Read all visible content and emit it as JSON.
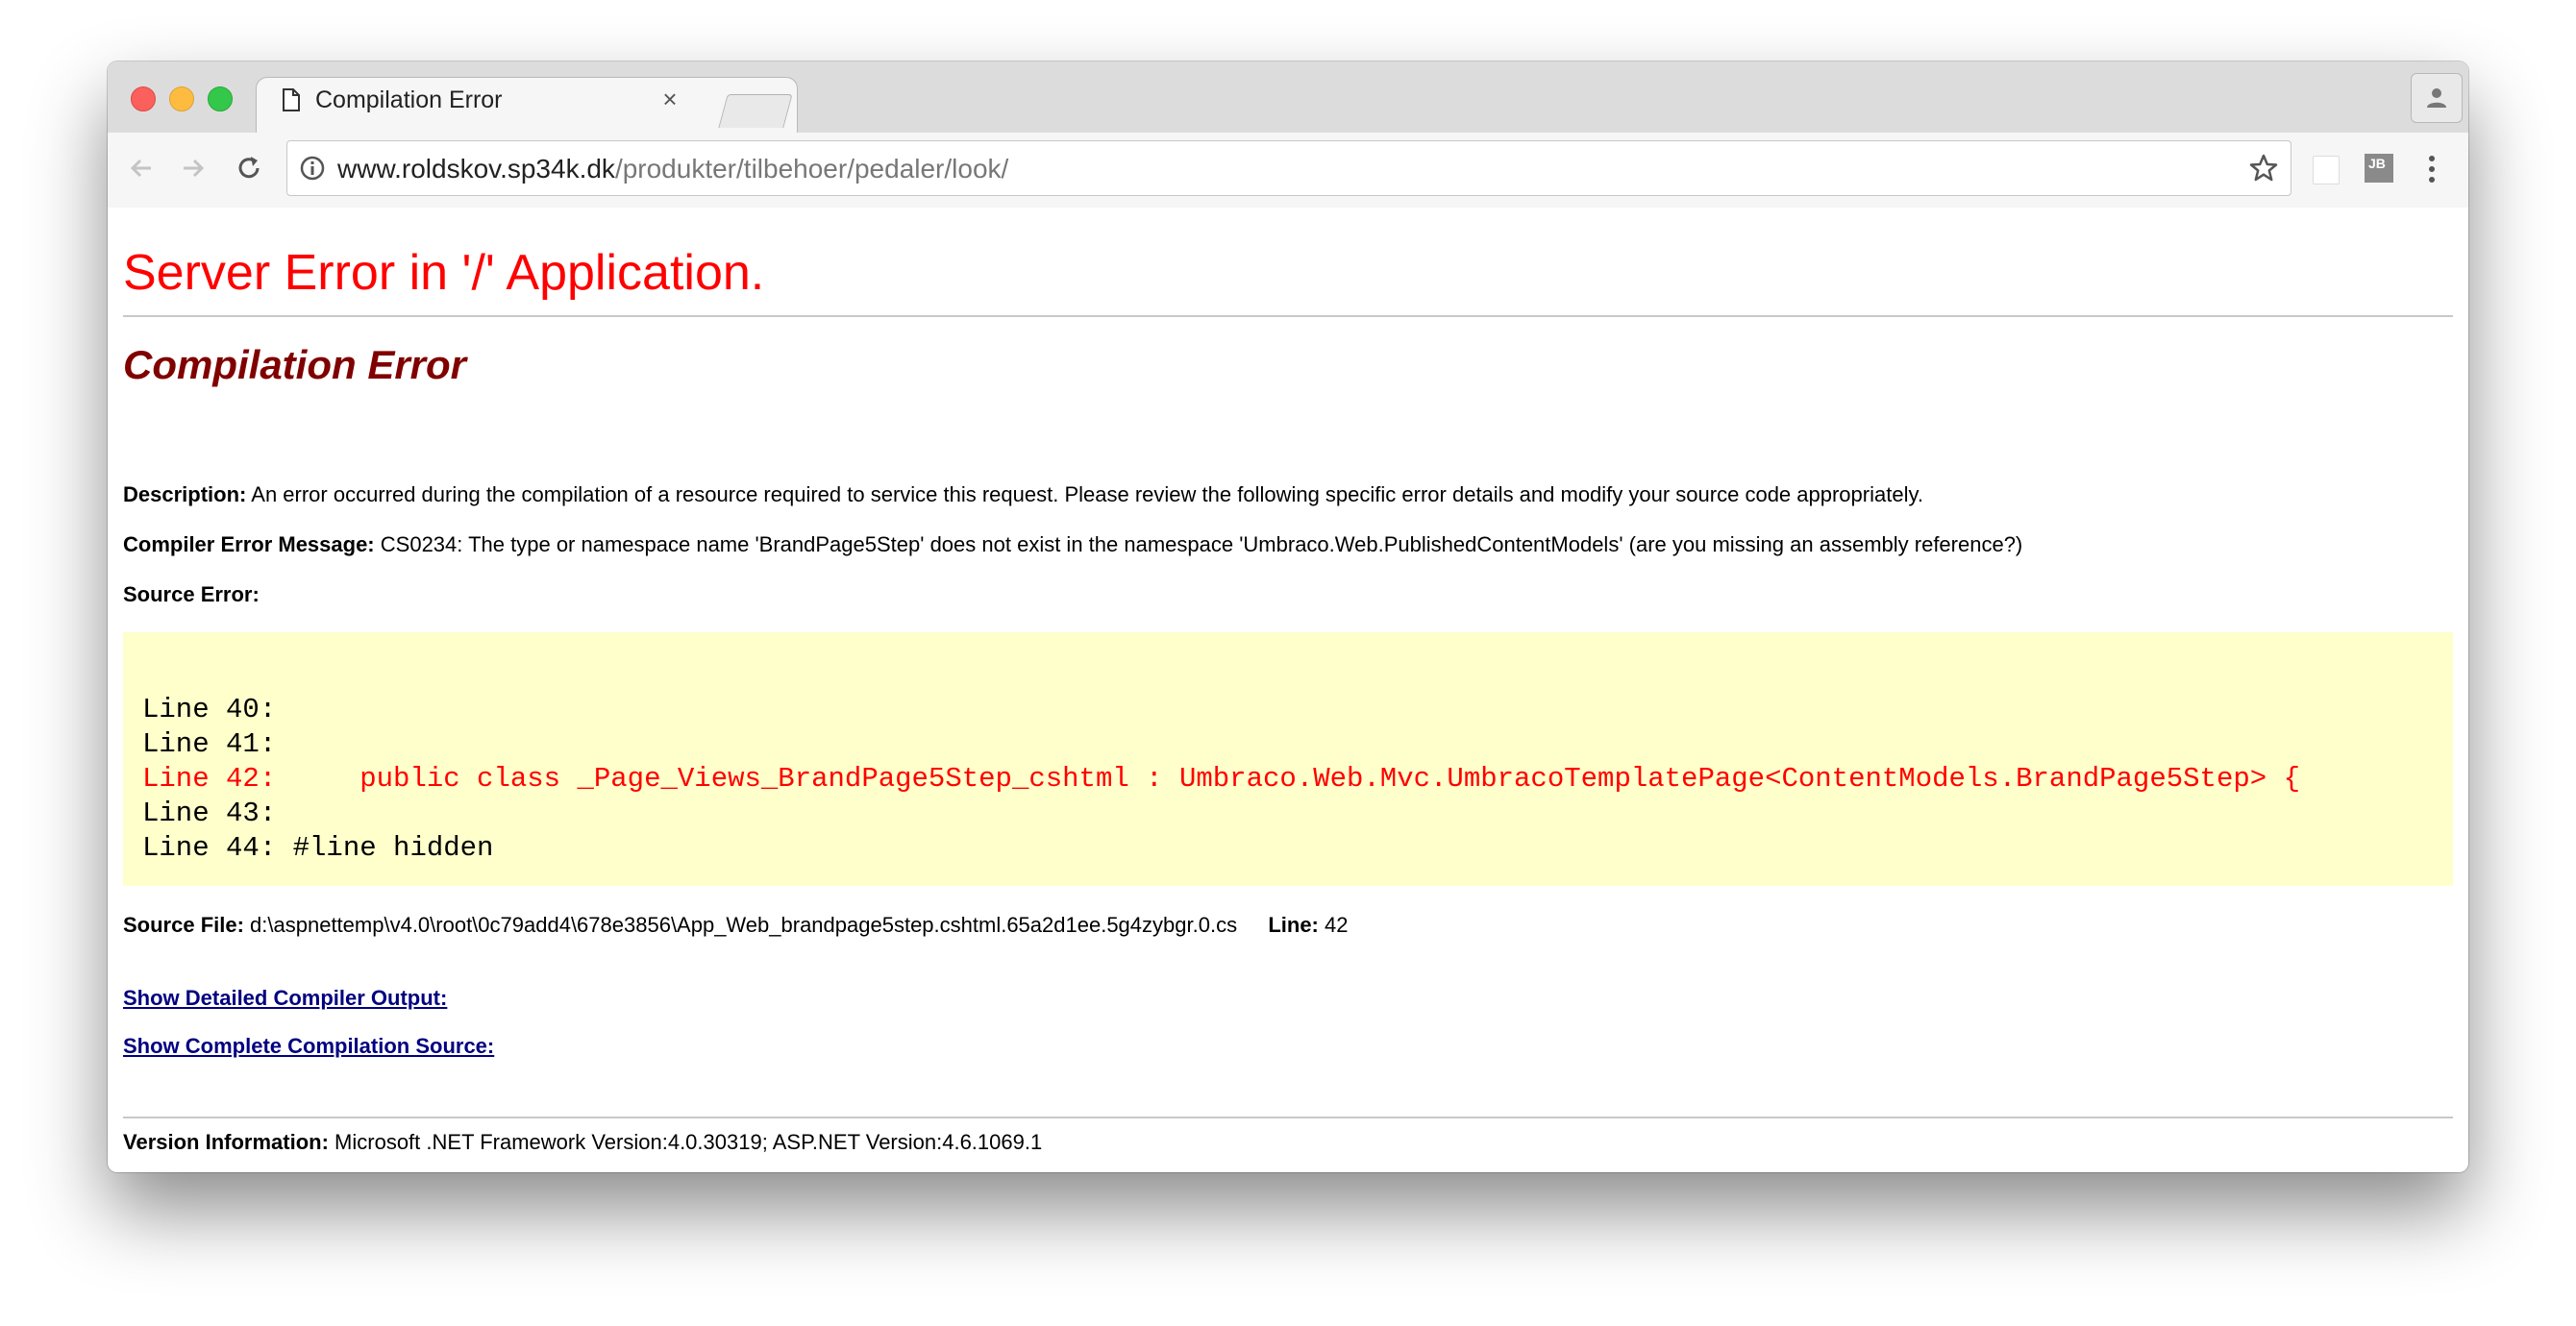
{
  "browser": {
    "tab_title": "Compilation Error",
    "tab_close": "×",
    "url_host": "www.roldskov.sp34k.dk",
    "url_path": "/produkter/tilbehoer/pedaler/look/",
    "icons": [
      "back-icon",
      "forward-icon",
      "reload-icon",
      "info-icon",
      "star-icon",
      "extension-blank-icon",
      "jetbrains-icon",
      "menu-icon",
      "profile-icon",
      "document-icon"
    ],
    "ext_label": "JB"
  },
  "page": {
    "heading": "Server Error in '/' Application.",
    "subheading": "Compilation Error",
    "description_label": "Description:",
    "description_text": "An error occurred during the compilation of a resource required to service this request. Please review the following specific error details and modify your source code appropriately.",
    "compiler_label": "Compiler Error Message:",
    "compiler_text": "CS0234: The type or namespace name 'BrandPage5Step' does not exist in the namespace 'Umbraco.Web.PublishedContentModels' (are you missing an assembly reference?)",
    "source_error_label": "Source Error:",
    "code_lines": [
      "Line 40:",
      "Line 41:",
      "Line 42:     public class _Page_Views_BrandPage5Step_cshtml : Umbraco.Web.Mvc.UmbracoTemplatePage<ContentModels.BrandPage5Step> {",
      "Line 43:",
      "Line 44: #line hidden"
    ],
    "source_file_label": "Source File:",
    "source_file_text": "d:\\aspnettemp\\v4.0\\root\\0c79add4\\678e3856\\App_Web_brandpage5step.cshtml.65a2d1ee.5g4zybgr.0.cs",
    "line_label": "Line:",
    "line_value": "42",
    "link_detailed": "Show Detailed Compiler Output:",
    "link_complete": "Show Complete Compilation Source:",
    "version_label": "Version Information:",
    "version_text": "Microsoft .NET Framework Version:4.0.30319; ASP.NET Version:4.6.1069.1"
  }
}
